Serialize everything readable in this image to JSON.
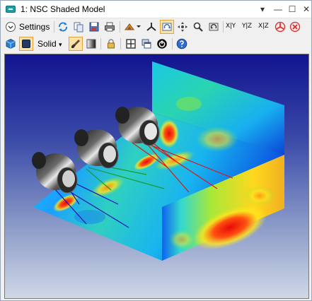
{
  "window": {
    "title": "1: NSC Shaded Model",
    "controls": {
      "dropdown": "▾",
      "minimize": "—",
      "maximize": "☐",
      "close": "✕"
    }
  },
  "toolbar1": {
    "settings_label": "Settings",
    "axis_buttons": [
      "X|Y",
      "Y|Z",
      "X|Z"
    ]
  },
  "toolbar2": {
    "render_mode": "Solid"
  },
  "viewport": {
    "description_colors": {
      "low": "#0a14c8",
      "mid": "#19c8e6",
      "mid2": "#8fe63c",
      "high": "#ffe61e",
      "peak": "#e60a0a"
    }
  },
  "colors": {
    "accent_active": "#fbe2a8",
    "background_top": "#11148f",
    "background_bottom": "#d0d8e6"
  }
}
